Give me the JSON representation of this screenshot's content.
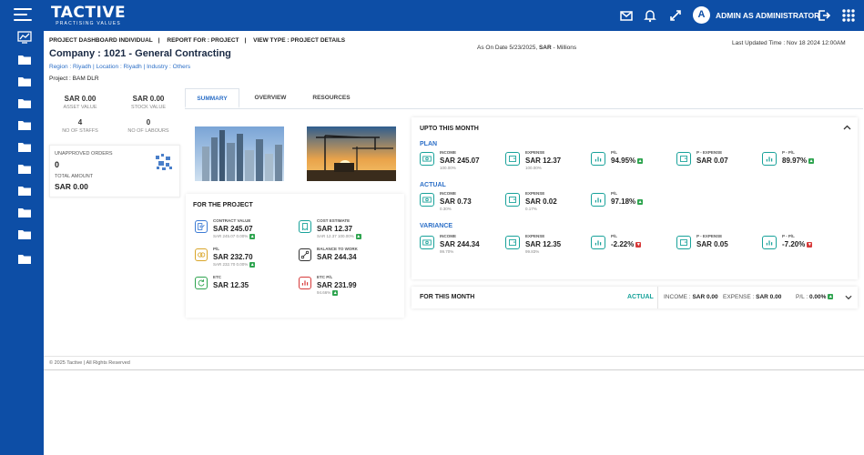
{
  "app": {
    "logo": "TACTIVE",
    "tagline": "PRACTISING VALUES",
    "user_initial": "A",
    "user_name": "ADMIN AS ADMINISTRATOR"
  },
  "icons": {
    "menu": "hamburger-icon",
    "mail": "mail-icon",
    "bell": "bell-icon",
    "expand": "expand-icon",
    "logout": "logout-icon",
    "apps": "grid-icon"
  },
  "sidebar": {
    "items": [
      "chart-icon",
      "folder-icon",
      "folder-icon",
      "folder-icon",
      "folder-icon",
      "folder-icon",
      "folder-icon",
      "folder-icon",
      "folder-icon",
      "folder-icon",
      "folder-icon"
    ]
  },
  "header": {
    "crumb1": "PROJECT DASHBOARD INDIVIDUAL",
    "crumb2": "REPORT FOR : PROJECT",
    "crumb3": "VIEW TYPE : PROJECT DETAILS",
    "as_on_prefix": "As On Date 5/23/2025,",
    "as_on_currency": "SAR",
    "as_on_suffix": "- Millions",
    "last_updated": "Last Updated Time : Nov 18 2024 12:00AM",
    "company": "Company : 1021 - General Contracting",
    "region": "Region : Riyadh",
    "location": "Location : Riyadh",
    "industry": "Industry : Others",
    "project": "Project : BAM DLR"
  },
  "left_metrics": {
    "asset_value": "SAR 0.00",
    "asset_label": "ASSET VALUE",
    "stock_value": "SAR 0.00",
    "stock_label": "STOCK VALUE",
    "staffs": "4",
    "staffs_label": "NO OF STAFFS",
    "labours": "0",
    "labours_label": "NO OF LABOURS"
  },
  "orders": {
    "title": "UNAPPROVED ORDERS",
    "count": "0",
    "total_label": "TOTAL AMOUNT",
    "total": "SAR 0.00"
  },
  "tabs": [
    "SUMMARY",
    "OVERVIEW",
    "RESOURCES"
  ],
  "project": {
    "title": "FOR THE PROJECT",
    "contract_label": "CONTRACT VALUE",
    "contract_value": "SAR 245.07",
    "contract_sub": "SAR 245.07 0.00%",
    "cost_label": "COST ESTIMATE",
    "cost_value": "SAR 12.37",
    "cost_sub": "SAR 12.37 100.00%",
    "pl_label": "P/L",
    "pl_value": "SAR 232.70",
    "pl_sub": "SAR 232.70 0.00%",
    "btw_label": "BALANCE TO WORK",
    "btw_value": "SAR 244.34",
    "etc_label": "ETC",
    "etc_value": "SAR 12.35",
    "etcpl_label": "ETC P/L",
    "etcpl_value": "SAR 231.99",
    "etcpl_sub": "94.66%"
  },
  "month": {
    "title": "UPTO THIS MONTH",
    "plan_label": "PLAN",
    "actual_label": "ACTUAL",
    "variance_label": "VARIANCE",
    "income": "INCOME",
    "expense": "EXPENSE",
    "pl": "P/L",
    "pexp": "P - EXPENSE",
    "ppl": "P - P/L",
    "plan": {
      "income": "SAR 245.07",
      "income_sub": "100.00%",
      "expense": "SAR 12.37",
      "expense_sub": "100.00%",
      "pl": "94.95%",
      "pexp": "SAR 0.07",
      "ppl": "89.97%"
    },
    "actual": {
      "income": "SAR 0.73",
      "income_sub": "0.30%",
      "expense": "SAR 0.02",
      "expense_sub": "0.17%",
      "pl": "97.18%"
    },
    "variance": {
      "income": "SAR 244.34",
      "income_sub": "99.70%",
      "expense": "SAR 12.35",
      "expense_sub": "99.83%",
      "pl": "-2.22%",
      "pexp": "SAR 0.05",
      "ppl": "-7.20%"
    }
  },
  "this_month": {
    "title": "FOR THIS MONTH",
    "actual": "ACTUAL",
    "income_label": "INCOME :",
    "income": "SAR 0.00",
    "expense_label": "EXPENSE :",
    "expense": "SAR 0.00",
    "pl_label": "P/L :",
    "pl": "0.00%"
  },
  "footer": "© 2025 Tactive | All Rights Reserved",
  "colors": {
    "brand": "#0d4ea6",
    "accent": "#2c6fc7",
    "teal": "#18a29a",
    "positive": "#2ea44f",
    "negative": "#d73a3a"
  }
}
